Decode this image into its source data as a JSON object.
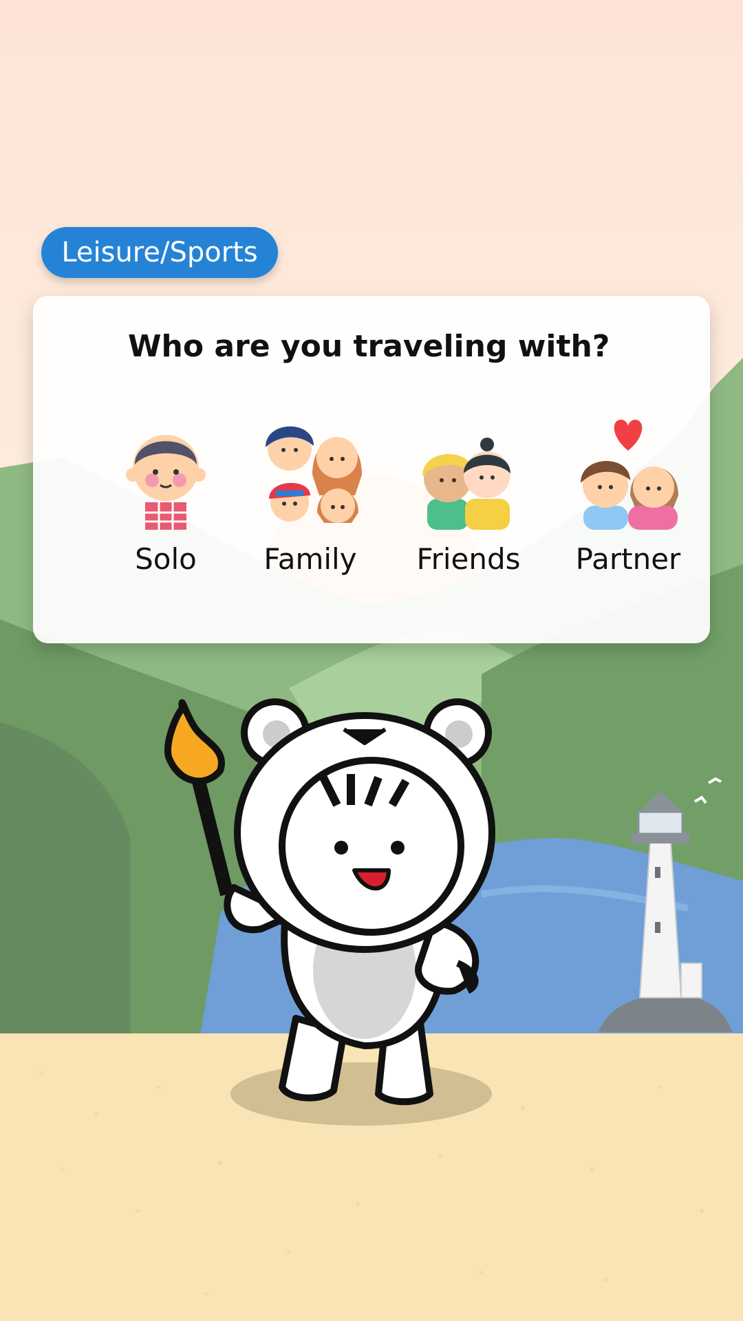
{
  "header": {
    "category_label": "Leisure/Sports"
  },
  "card": {
    "question": "Who are you traveling with?",
    "options": [
      {
        "label": "Solo",
        "icon": "solo-person-icon"
      },
      {
        "label": "Family",
        "icon": "family-icon"
      },
      {
        "label": "Friends",
        "icon": "friends-icon"
      },
      {
        "label": "Partner",
        "icon": "partner-couple-icon"
      }
    ]
  },
  "colors": {
    "category_badge": "#2583d6",
    "sky": "#fde6d8",
    "sand": "#f8e4b4",
    "water": "#6f9fd6",
    "hills": "#78a86c",
    "partner_heart": "#f04045"
  }
}
